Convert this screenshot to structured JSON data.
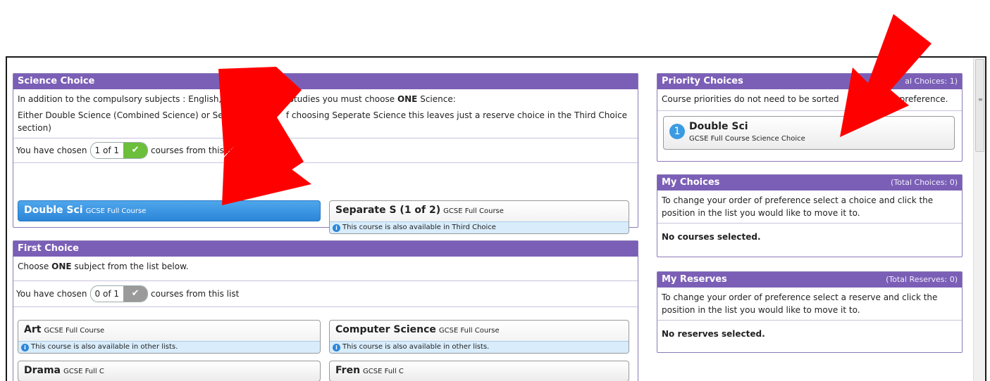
{
  "science": {
    "title": "Science Choice",
    "intro_prefix": "In addition to the compulsory subjects : English, Math a",
    "intro_suffix": "s Studies you must choose",
    "intro_bold": "ONE",
    "intro_end": "Science:",
    "detail_a": "Either Double Science (Combined Science) or Separa",
    "detail_b": "f choosing Seperate Science this leaves just a reserve choice in the Third Choice",
    "detail_c": "section)",
    "chosen_prefix": "You have chosen",
    "chosen_count": "1 of 1",
    "chosen_suffix": "courses from this li",
    "courses": [
      {
        "name": "Double Sci",
        "type": "GCSE Full Course",
        "note": ""
      },
      {
        "name": "Separate S  (1 of 2)",
        "type": "GCSE Full Course",
        "note": "This course is also available in Third Choice"
      }
    ]
  },
  "first": {
    "title": "First Choice",
    "intro_prefix": "Choose",
    "intro_bold": "ONE",
    "intro_suffix": "subject from the list below.",
    "chosen_prefix": "You have chosen",
    "chosen_count": "0 of 1",
    "chosen_suffix": "courses from this list",
    "courses": [
      {
        "name": "Art",
        "type": "GCSE Full Course",
        "note": "This course is also available in other lists."
      },
      {
        "name": "Computer Science",
        "type": "GCSE Full Course",
        "note": "This course is also available in other lists."
      },
      {
        "name": "Drama",
        "type": "GCSE Full C",
        "note": ""
      },
      {
        "name": "Fren",
        "type": "GCSE Full C",
        "note": ""
      }
    ]
  },
  "priority": {
    "title": "Priority Choices",
    "total": "al Choices: 1)",
    "text_a": "Course priorities do not need to be sorted",
    "text_b": "preference.",
    "card_rank": "1",
    "card_title": "Double Sci",
    "card_sub": "GCSE Full Course Science Choice"
  },
  "my_choices": {
    "title": "My Choices",
    "total": "(Total Choices: 0)",
    "text": "To change your order of preference select a choice and click the position in the list you would like to move it to.",
    "empty": "No courses selected."
  },
  "my_reserves": {
    "title": "My Reserves",
    "total": "(Total Reserves: 0)",
    "text": "To change your order of preference select a reserve and click the position in the list you would like to move it to.",
    "empty": "No reserves selected."
  },
  "icons": {
    "check": "check-icon",
    "info": "info-icon",
    "arrow": "red-arrow"
  },
  "colors": {
    "header": "#7b5fb6",
    "selected": "#2c86d8",
    "arrow": "#ff0000",
    "check_green": "#6cbf3a"
  }
}
